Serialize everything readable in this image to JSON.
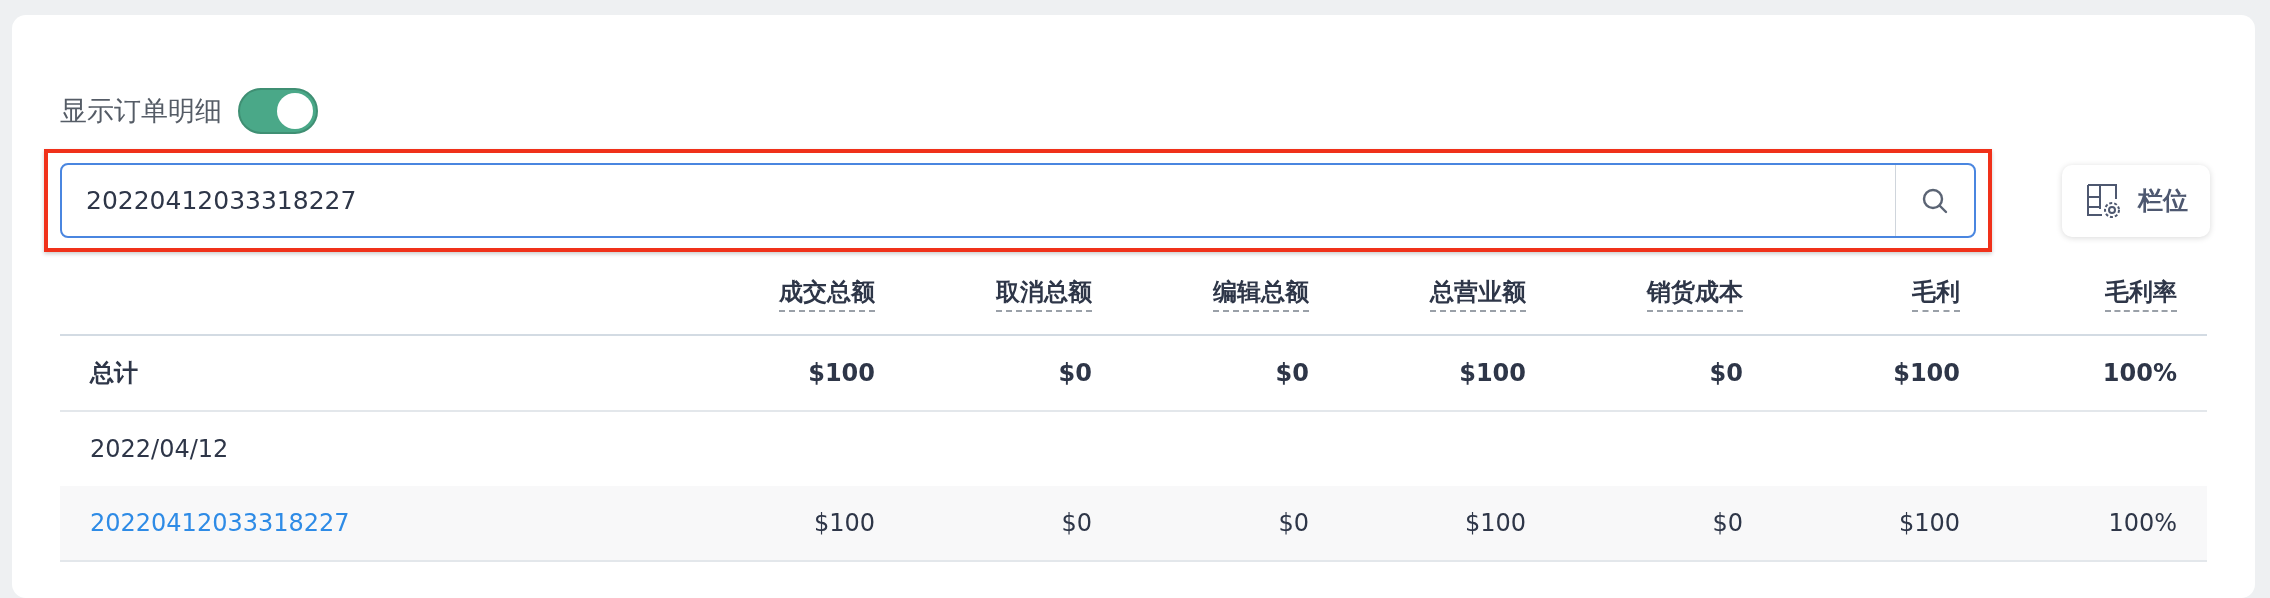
{
  "toggle": {
    "label": "显示订单明细",
    "on": true
  },
  "search": {
    "value": "20220412033318227",
    "highlighted": true
  },
  "columns_button": {
    "label": "栏位"
  },
  "table": {
    "columns": [
      "成交总额",
      "取消总额",
      "编辑总额",
      "总营业额",
      "销货成本",
      "毛利",
      "毛利率"
    ],
    "total_row": {
      "label": "总计",
      "cells": [
        "$100",
        "$0",
        "$0",
        "$100",
        "$0",
        "$100",
        "100%"
      ]
    },
    "groups": [
      {
        "date": "2022/04/12",
        "rows": [
          {
            "order": "20220412033318227",
            "cells": [
              "$100",
              "$0",
              "$0",
              "$100",
              "$0",
              "$100",
              "100%"
            ]
          }
        ]
      }
    ]
  }
}
